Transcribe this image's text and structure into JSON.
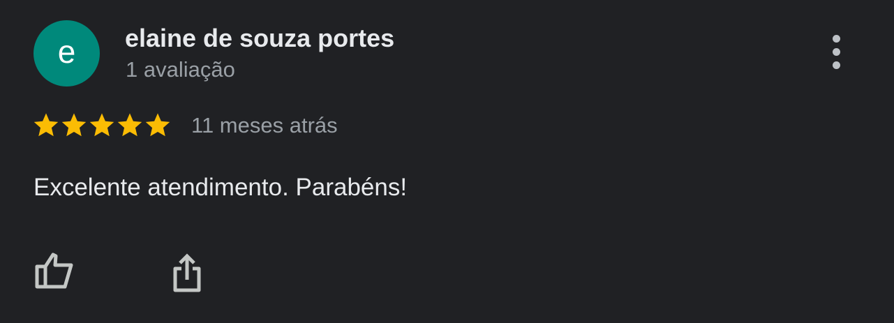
{
  "review": {
    "avatar_letter": "e",
    "avatar_color": "#00897b",
    "author": "elaine de souza portes",
    "review_count": "1 avaliação",
    "rating": 5,
    "rating_max": 5,
    "star_color": "#fbbc04",
    "time": "11 meses atrás",
    "text": "Excelente atendimento. Parabéns!"
  },
  "icons": {
    "more": "more-vert-icon",
    "like": "thumb-up-icon",
    "share": "share-icon"
  }
}
